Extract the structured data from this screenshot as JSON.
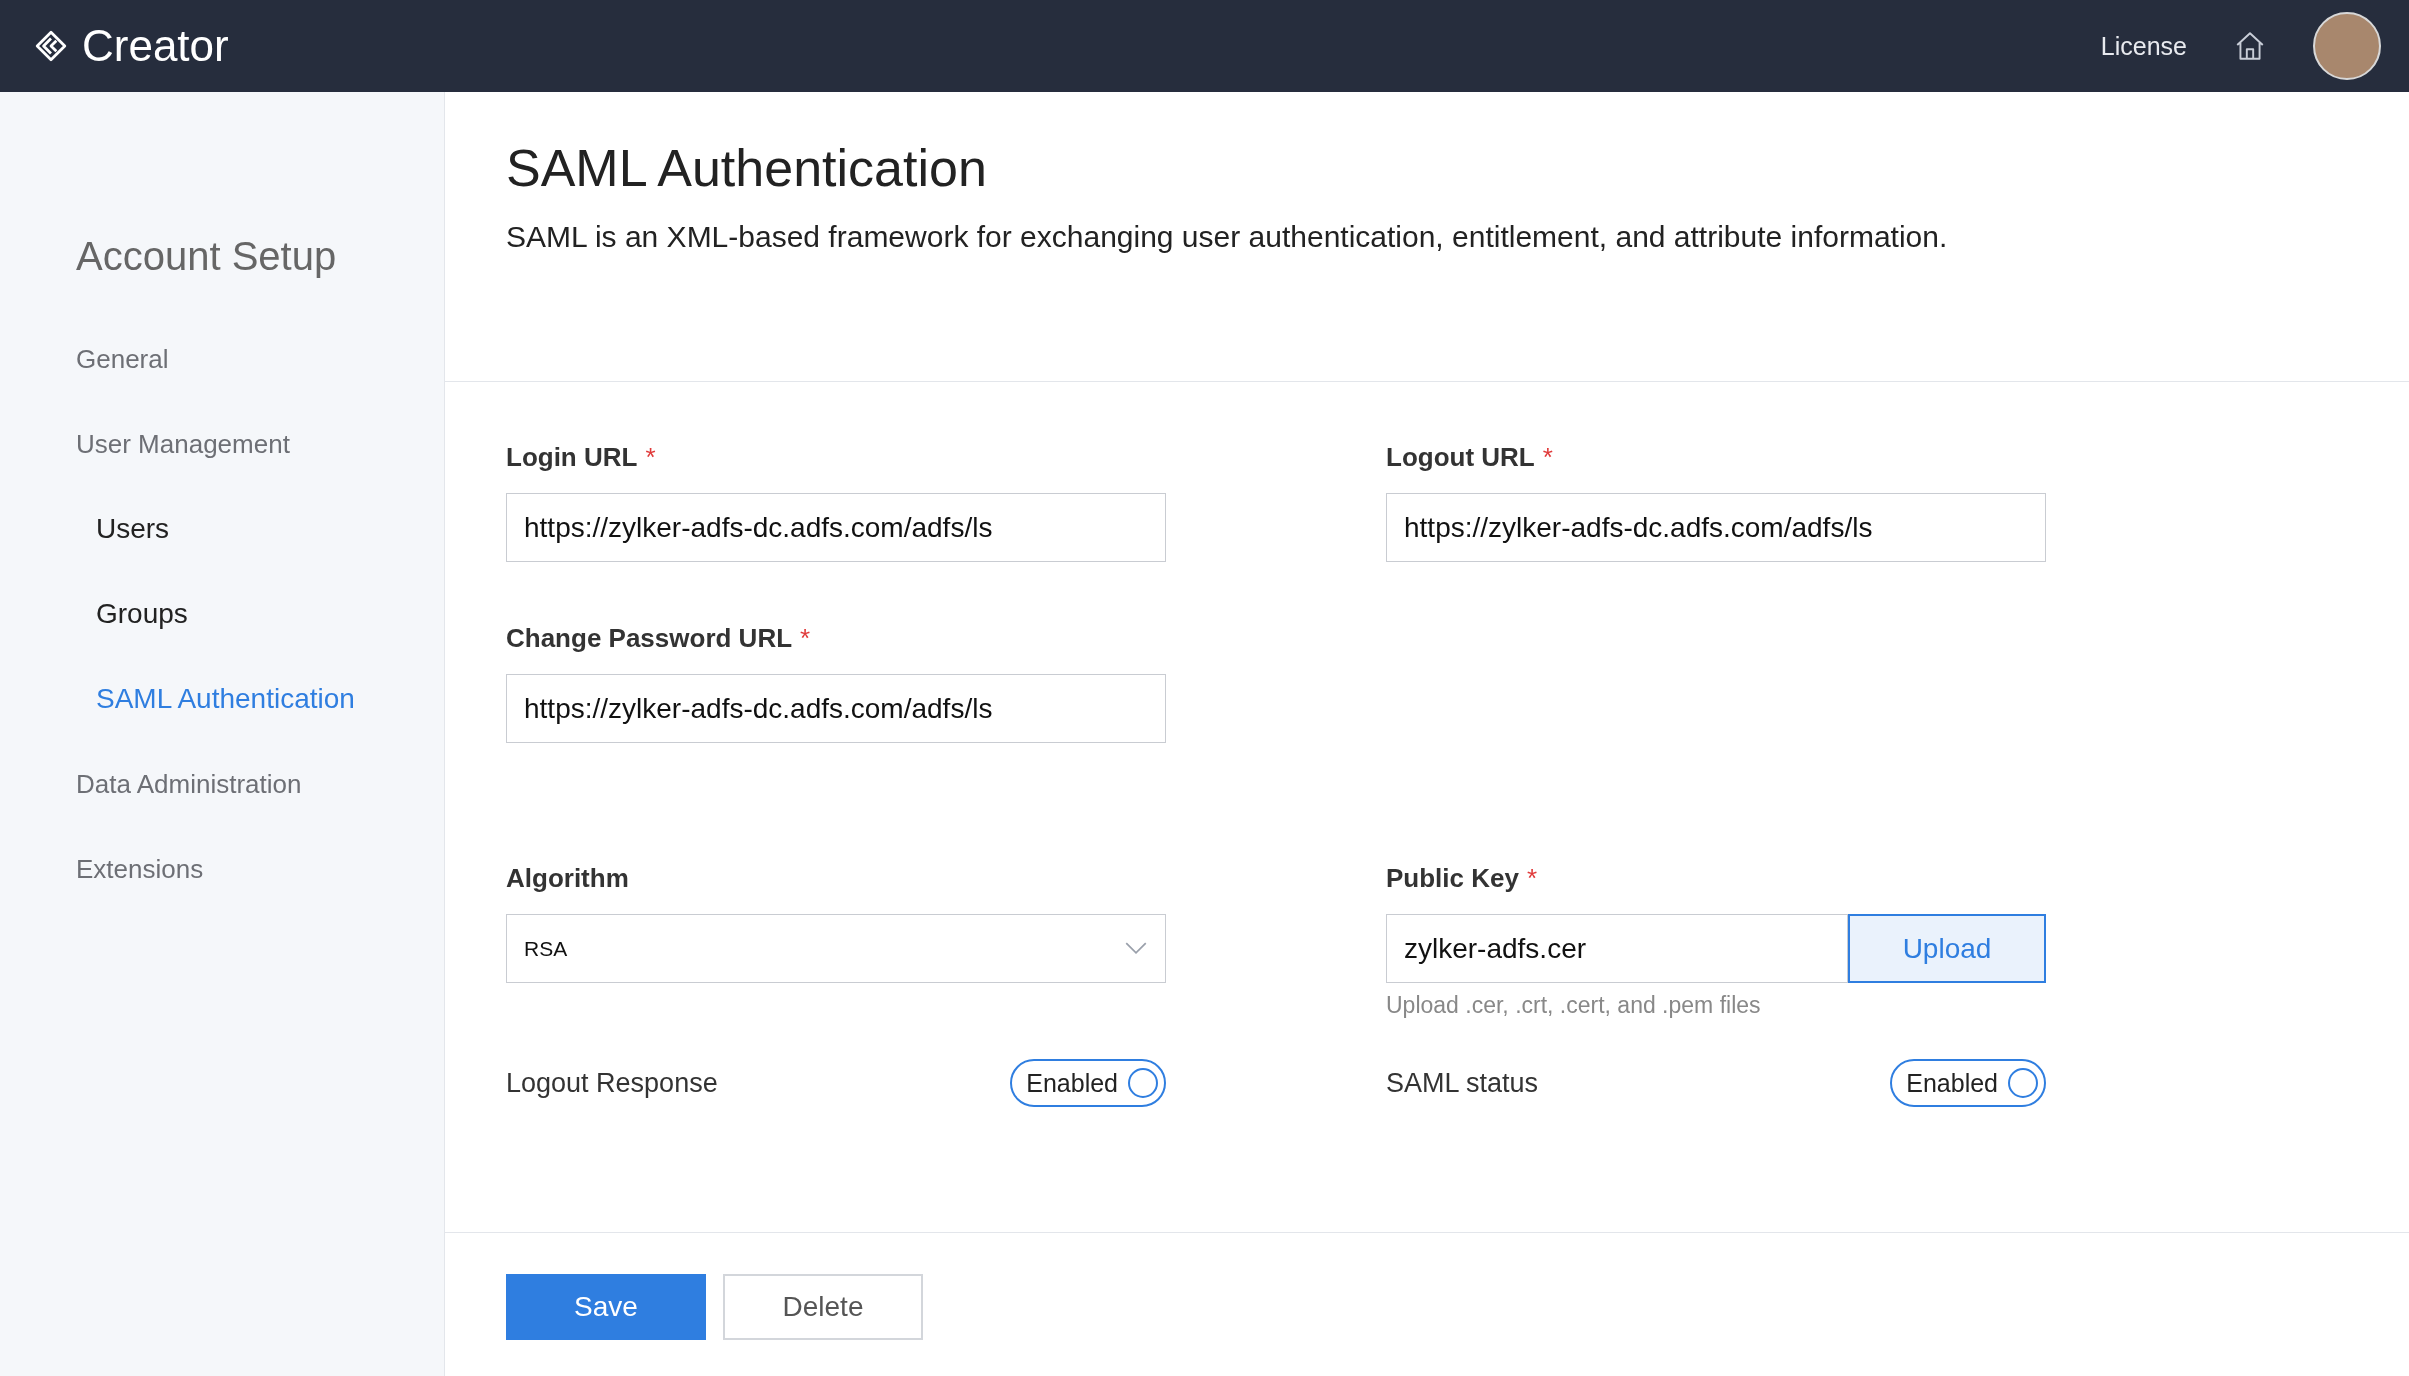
{
  "header": {
    "logo": "Creator",
    "license": "License"
  },
  "sidebar": {
    "title": "Account Setup",
    "items": [
      {
        "label": "General",
        "selected": false
      },
      {
        "label": "User Management",
        "selected": false,
        "children": [
          {
            "label": "Users",
            "selected": false
          },
          {
            "label": "Groups",
            "selected": false
          },
          {
            "label": "SAML Authentication",
            "selected": true
          }
        ]
      },
      {
        "label": "Data Administration",
        "selected": false
      },
      {
        "label": "Extensions",
        "selected": false
      }
    ]
  },
  "page": {
    "title": "SAML Authentication",
    "description": "SAML is an XML-based framework for exchanging user authentication, entitlement, and attribute information."
  },
  "rows": [
    [
      {
        "kind": "text",
        "label": "Login URL",
        "required_mark": "*",
        "value": "https://zylker-adfs-dc.adfs.com/adfs/ls"
      },
      {
        "kind": "text",
        "label": "Logout URL",
        "required_mark": "*",
        "value": "https://zylker-adfs-dc.adfs.com/adfs/ls"
      }
    ],
    [
      {
        "kind": "text",
        "label": "Change Password URL",
        "required_mark": "*",
        "value": "https://zylker-adfs-dc.adfs.com/adfs/ls"
      }
    ],
    [
      {
        "kind": "select",
        "label": "Algorithm",
        "value": "RSA"
      },
      {
        "kind": "file",
        "label": "Public Key",
        "required_mark": "*",
        "value": "zylker-adfs.cer",
        "button": "Upload",
        "hint": "Upload .cer, .crt, .cert, and .pem files"
      }
    ],
    [
      {
        "kind": "toggle",
        "label": "Logout Response",
        "state_label": "Enabled",
        "on": true
      },
      {
        "kind": "toggle",
        "label": "SAML status",
        "state_label": "Enabled",
        "on": true
      }
    ]
  ],
  "buttons": [
    {
      "label": "Save",
      "kind": "primary"
    },
    {
      "label": "Delete",
      "kind": "secondary"
    }
  ]
}
